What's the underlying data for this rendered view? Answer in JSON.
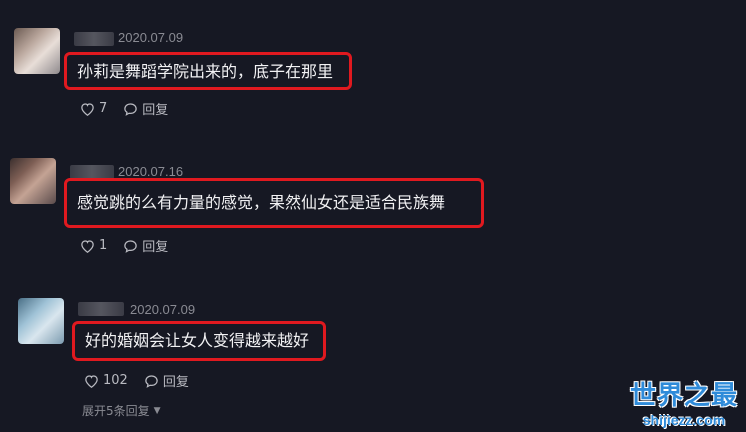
{
  "comments": [
    {
      "date": "2020.07.09",
      "text": "孙莉是舞蹈学院出来的，底子在那里",
      "likes": "7",
      "reply_label": "回复"
    },
    {
      "date": "2020.07.16",
      "text": "感觉跳的么有力量的感觉，果然仙女还是适合民族舞",
      "likes": "1",
      "reply_label": "回复"
    },
    {
      "date": "2020.07.09",
      "text": "好的婚姻会让女人变得越来越好",
      "likes": "102",
      "reply_label": "回复"
    }
  ],
  "expand_replies_label": "展开5条回复",
  "watermark": {
    "title": "世界之最",
    "url": "shijiezz.com"
  },
  "colors": {
    "background": "#161823",
    "highlight_border": "#e0191f",
    "muted_text": "#8a8b93",
    "watermark_blue": "#2f8bd9"
  }
}
